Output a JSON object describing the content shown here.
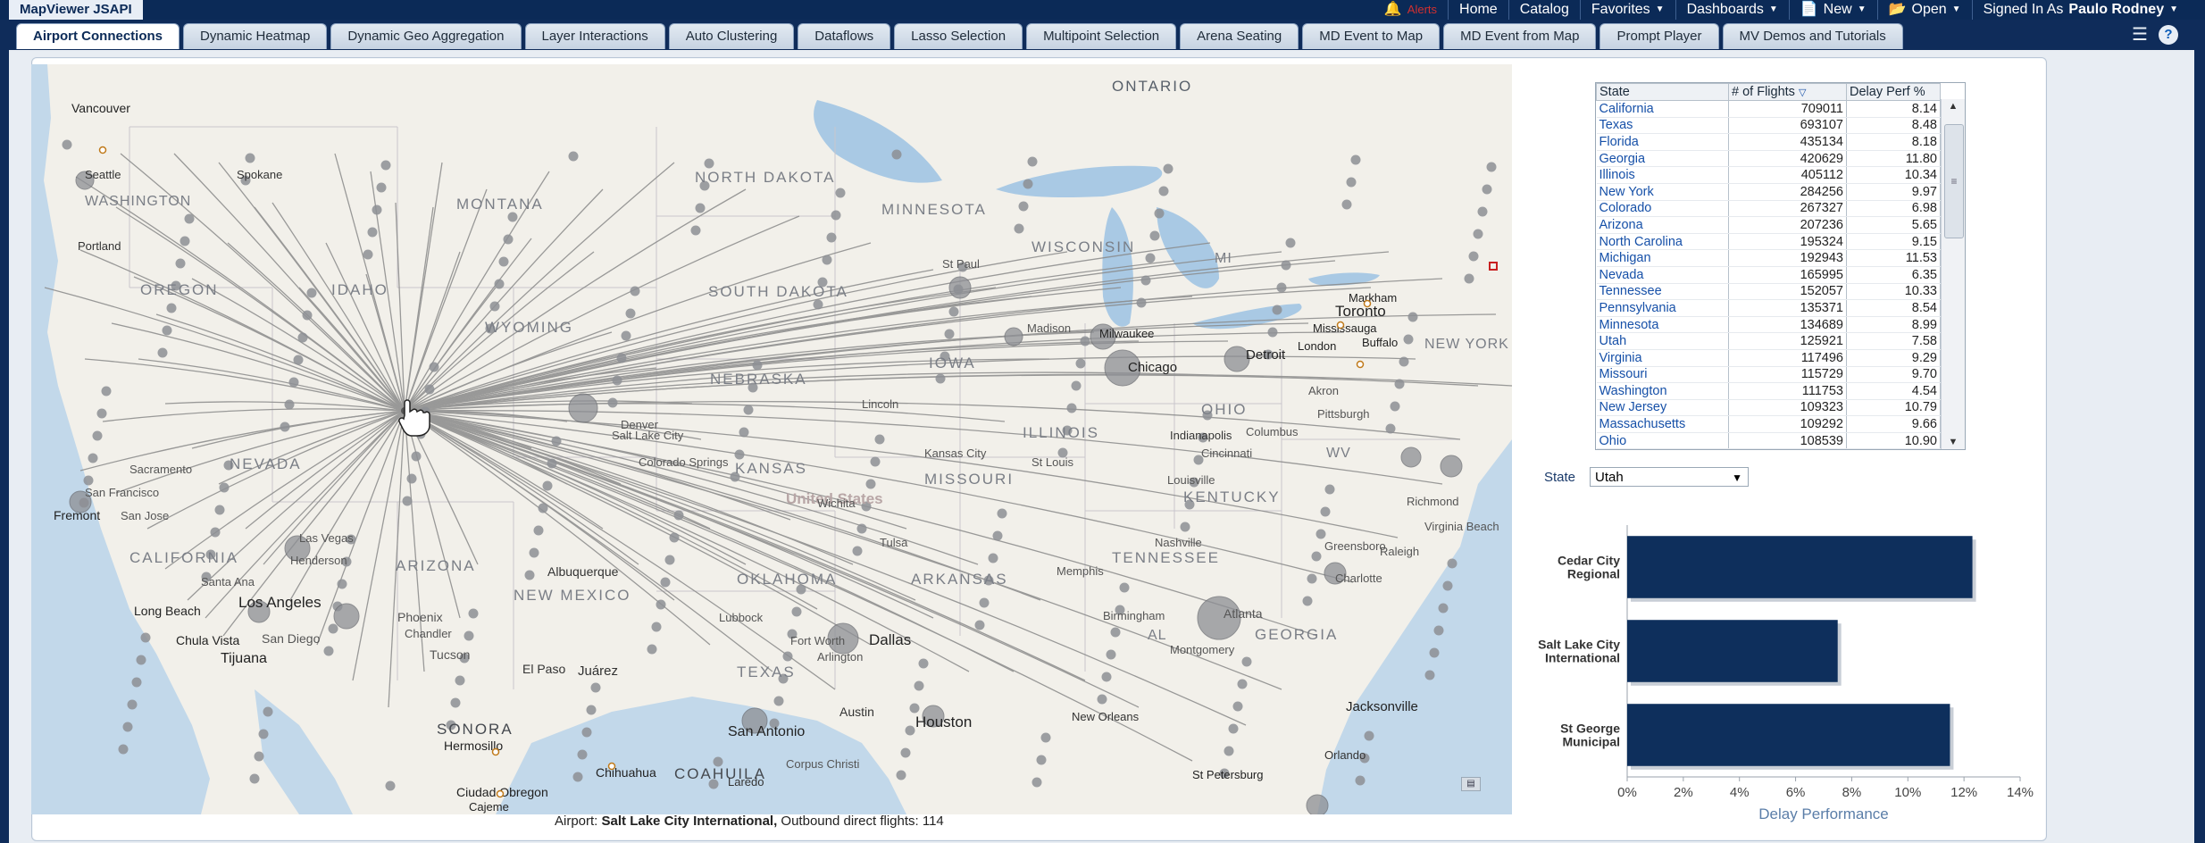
{
  "header": {
    "app_title": "MapViewer JSAPI",
    "alerts_label": "Alerts",
    "nav": [
      "Home",
      "Catalog",
      "Favorites",
      "Dashboards",
      "New",
      "Open"
    ],
    "signed_in_label": "Signed In As",
    "user_name": "Paulo Rodney"
  },
  "tabs": [
    "Airport Connections",
    "Dynamic Heatmap",
    "Dynamic Geo Aggregation",
    "Layer Interactions",
    "Auto Clustering",
    "Dataflows",
    "Lasso Selection",
    "Multipoint Selection",
    "Arena Seating",
    "MD Event to Map",
    "MD Event from Map",
    "Prompt Player",
    "MV Demos and Tutorials"
  ],
  "active_tab": "Airport Connections",
  "map": {
    "labels": {
      "ontario": "ONTARIO",
      "north_dakota": "NORTH DAKOTA",
      "montana": "MONTANA",
      "minnesota": "MINNESOTA",
      "wisconsin": "WISCONSIN",
      "south_dakota": "SOUTH DAKOTA",
      "wyoming": "WYOMING",
      "nebraska": "NEBRASKA",
      "oregon": "OREGON",
      "idaho": "IDAHO",
      "nevada": "NEVADA",
      "california": "CALIFORNIA",
      "arizona": "ARIZONA",
      "new_mexico": "NEW MEXICO",
      "kansas": "KANSAS",
      "missouri": "MISSOURI",
      "oklahoma": "OKLAHOMA",
      "arkansas": "ARKANSAS",
      "texas": "TEXAS",
      "iowa": "IOWA",
      "illinois": "ILLINOIS",
      "ohio": "OHIO",
      "kentucky": "KENTUCKY",
      "tennessee": "TENNESSEE",
      "georgia": "GEORGIA",
      "sonora": "SONORA",
      "coahuila": "COAHUILA",
      "washington": "WASHINGTON",
      "new_york": "NEW YORK",
      "united_states": "United States",
      "vancouver": "Vancouver",
      "portland": "Portland",
      "seattle": "Seattle",
      "spokane": "Spokane",
      "toronto": "Toronto",
      "markham": "Markham",
      "mississauga": "Mississauga",
      "london": "London",
      "buffalo": "Buffalo",
      "detroit": "Detroit",
      "chicago": "Chicago",
      "milwaukee": "Milwaukee",
      "indianapolis": "Indianapolis",
      "dallas": "Dallas",
      "houston": "Houston",
      "austin": "Austin",
      "san_antonio": "San Antonio",
      "los_angeles": "Los Angeles",
      "long_beach": "Long Beach",
      "tijuana": "Tijuana",
      "chula_vista": "Chula Vista",
      "san_diego": "San Diego",
      "phoenix": "Phoenix",
      "tucson": "Tucson",
      "el_paso": "El Paso",
      "juarez": "Juárez",
      "albuquerque": "Albuquerque",
      "hermosillo": "Hermosillo",
      "chihuahua": "Chihuahua",
      "ciudad_obregon": "Ciudad Obregon",
      "cajeme": "Cajeme",
      "atlanta": "Atlanta",
      "jacksonville": "Jacksonville",
      "new_orleans": "New Orleans",
      "st_petersburg": "St Petersburg",
      "orlando": "Orlando",
      "fremont": "Fremont",
      "san_jose": "San Jose",
      "san_francisco": "San Francisco",
      "st_paul": "St Paul",
      "nashville": "Nashville",
      "memphis": "Memphis",
      "louisville": "Louisville",
      "cincinnati": "Cincinnati",
      "columbus": "Columbus",
      "pittsburgh": "Pittsburgh",
      "richmond": "Richmond",
      "virginia_beach": "Virginia Beach",
      "raleigh": "Raleigh",
      "charlotte": "Charlotte",
      "greensboro": "Greensboro",
      "lincoln": "Lincoln",
      "kansas_city": "Kansas City",
      "wichita": "Wichita",
      "tulsa": "Tulsa",
      "lubbock": "Lubbock",
      "fort_worth": "Fort Worth",
      "arlington": "Arlington",
      "laredo": "Laredo",
      "corpus_christi": "Corpus Christi",
      "st_louis": "St Louis",
      "birmingham": "Birmingham",
      "montgomery": "Montgomery",
      "madison": "Madison",
      "chandler": "Chandler",
      "las_vegas": "Las Vegas",
      "henderson": "Henderson",
      "sacramento": "Sacramento",
      "salt_lake_city": "Salt Lake City",
      "denver": "Denver",
      "colorado_springs": "Colorado Springs",
      "akron": "Akron",
      "santa_ana": "Santa Ana",
      "mi": "MI",
      "wv": "WV",
      "al": "AL"
    },
    "caption_prefix": "Airport:",
    "caption_airport": "Salt Lake City International,",
    "caption_suffix": "Outbound direct flights: 114"
  },
  "table": {
    "headers": [
      "State",
      "# of Flights",
      "Delay Perf %"
    ],
    "rows": [
      [
        "California",
        "709011",
        "8.14"
      ],
      [
        "Texas",
        "693107",
        "8.48"
      ],
      [
        "Florida",
        "435134",
        "8.18"
      ],
      [
        "Georgia",
        "420629",
        "11.80"
      ],
      [
        "Illinois",
        "405112",
        "10.34"
      ],
      [
        "New York",
        "284256",
        "9.97"
      ],
      [
        "Colorado",
        "267327",
        "6.98"
      ],
      [
        "Arizona",
        "207236",
        "5.65"
      ],
      [
        "North Carolina",
        "195324",
        "9.15"
      ],
      [
        "Michigan",
        "192943",
        "11.53"
      ],
      [
        "Nevada",
        "165995",
        "6.35"
      ],
      [
        "Tennessee",
        "152057",
        "10.33"
      ],
      [
        "Pennsylvania",
        "135371",
        "8.54"
      ],
      [
        "Minnesota",
        "134689",
        "8.99"
      ],
      [
        "Utah",
        "125921",
        "7.58"
      ],
      [
        "Virginia",
        "117496",
        "9.29"
      ],
      [
        "Missouri",
        "115729",
        "9.70"
      ],
      [
        "Washington",
        "111753",
        "4.54"
      ],
      [
        "New Jersey",
        "109323",
        "10.79"
      ],
      [
        "Massachusetts",
        "109292",
        "9.66"
      ],
      [
        "Ohio",
        "108539",
        "10.90"
      ]
    ]
  },
  "state_prompt": {
    "label": "State",
    "value": "Utah"
  },
  "chart_data": {
    "type": "bar",
    "orientation": "horizontal",
    "categories": [
      [
        "Cedar City",
        "Regional"
      ],
      [
        "Salt Lake City",
        "International"
      ],
      [
        "St George",
        "Municipal"
      ]
    ],
    "values": [
      12.3,
      7.5,
      11.5
    ],
    "xlabel": "Delay Performance",
    "xlim": [
      0,
      14
    ],
    "xticks": [
      "0%",
      "2%",
      "4%",
      "6%",
      "8%",
      "10%",
      "12%",
      "14%"
    ],
    "bar_color": "#0e2f5c"
  }
}
